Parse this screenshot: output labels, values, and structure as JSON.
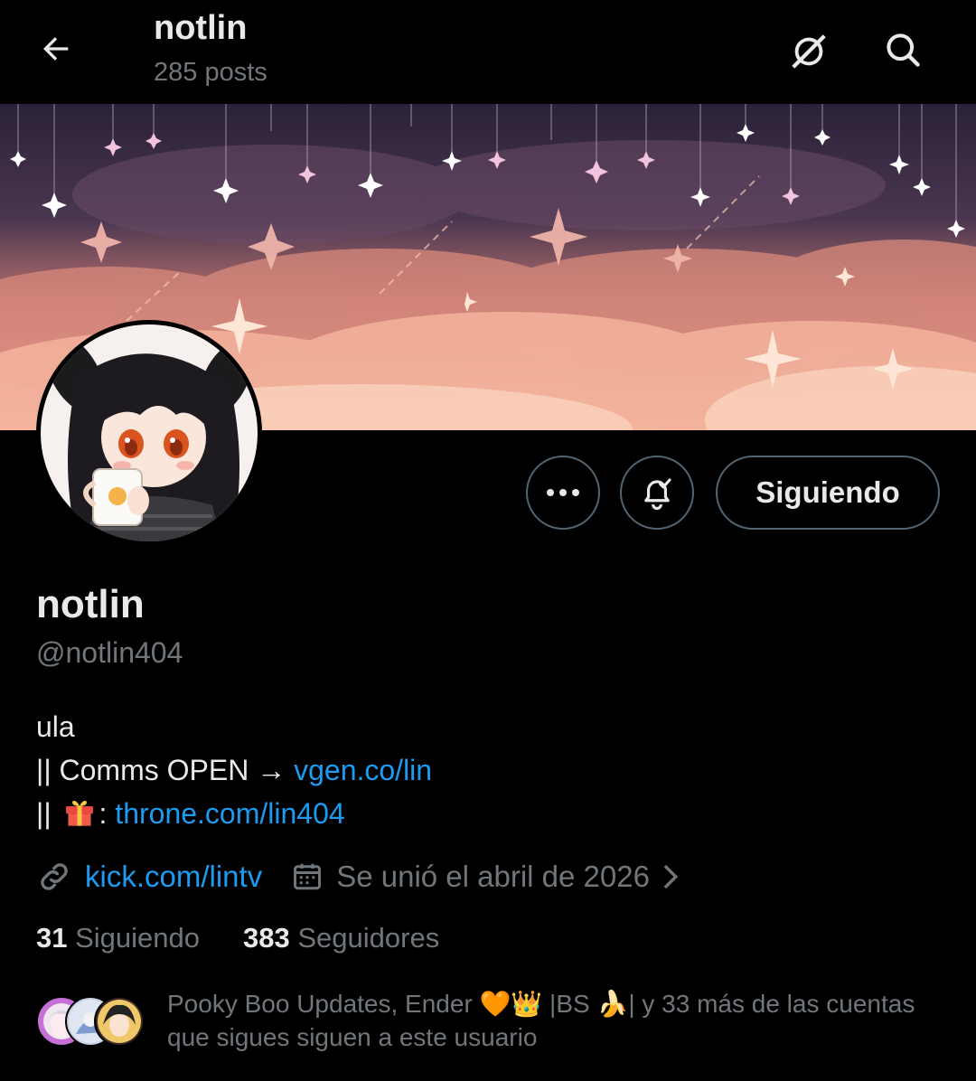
{
  "header": {
    "title": "notlin",
    "posts_count": "285 posts",
    "back_icon": "arrow-left-icon",
    "grok_icon": "grok-icon",
    "search_icon": "search-icon"
  },
  "banner": {
    "description_icon": "starry-sky-banner"
  },
  "actions": {
    "more_icon": "more-horizontal-icon",
    "notify_icon": "bell-check-icon",
    "follow_label": "Siguiendo"
  },
  "profile": {
    "display_name": "notlin",
    "handle": "@notlin404",
    "bio_line1": "ula",
    "bio_line2_prefix": "|| Comms OPEN → ",
    "bio_line2_link": "vgen.co/lin",
    "bio_line3_prefix": "|| ",
    "bio_line3_sep": ": ",
    "bio_line3_link": "throne.com/lin404",
    "website": "kick.com/lintv",
    "joined": "Se unió el abril de 2026",
    "following_count": "31",
    "following_label": "Siguiendo",
    "followers_count": "383",
    "followers_label": "Seguidores"
  },
  "followers_you_know": {
    "text": "Pooky Boo Updates, Ender 🧡👑 |BS 🍌| y 33 más de las cuentas que sigues siguen a este usuario"
  },
  "colors": {
    "background": "#000000",
    "text_primary": "#e7e9ea",
    "text_secondary": "#71767b",
    "link": "#1d9bf0",
    "border": "#536471"
  }
}
